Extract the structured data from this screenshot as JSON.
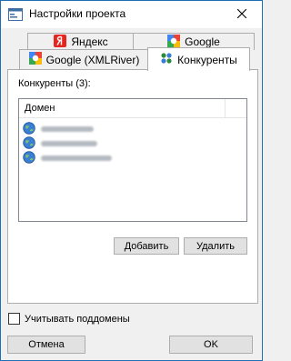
{
  "window": {
    "title": "Настройки проекта"
  },
  "tabs_back": [
    {
      "label": "Яндекс",
      "icon": "yandex-icon"
    },
    {
      "label": "Google",
      "icon": "google-icon"
    }
  ],
  "tabs_front": [
    {
      "label": "Google (XMLRiver)",
      "icon": "google-icon"
    },
    {
      "label": "Конкуренты",
      "icon": "competitors-icon",
      "active": true
    }
  ],
  "competitors": {
    "group_label": "Конкуренты (3):",
    "column_header": "Домен",
    "rows": [
      {
        "icon": "globe-icon",
        "domain": ""
      },
      {
        "icon": "globe-icon",
        "domain": ""
      },
      {
        "icon": "globe-icon",
        "domain": ""
      }
    ],
    "add_label": "Добавить",
    "delete_label": "Удалить"
  },
  "footer": {
    "subdomains_label": "Учитывать поддомены",
    "subdomains_checked": false,
    "cancel_label": "Отмена",
    "ok_label": "OK"
  }
}
